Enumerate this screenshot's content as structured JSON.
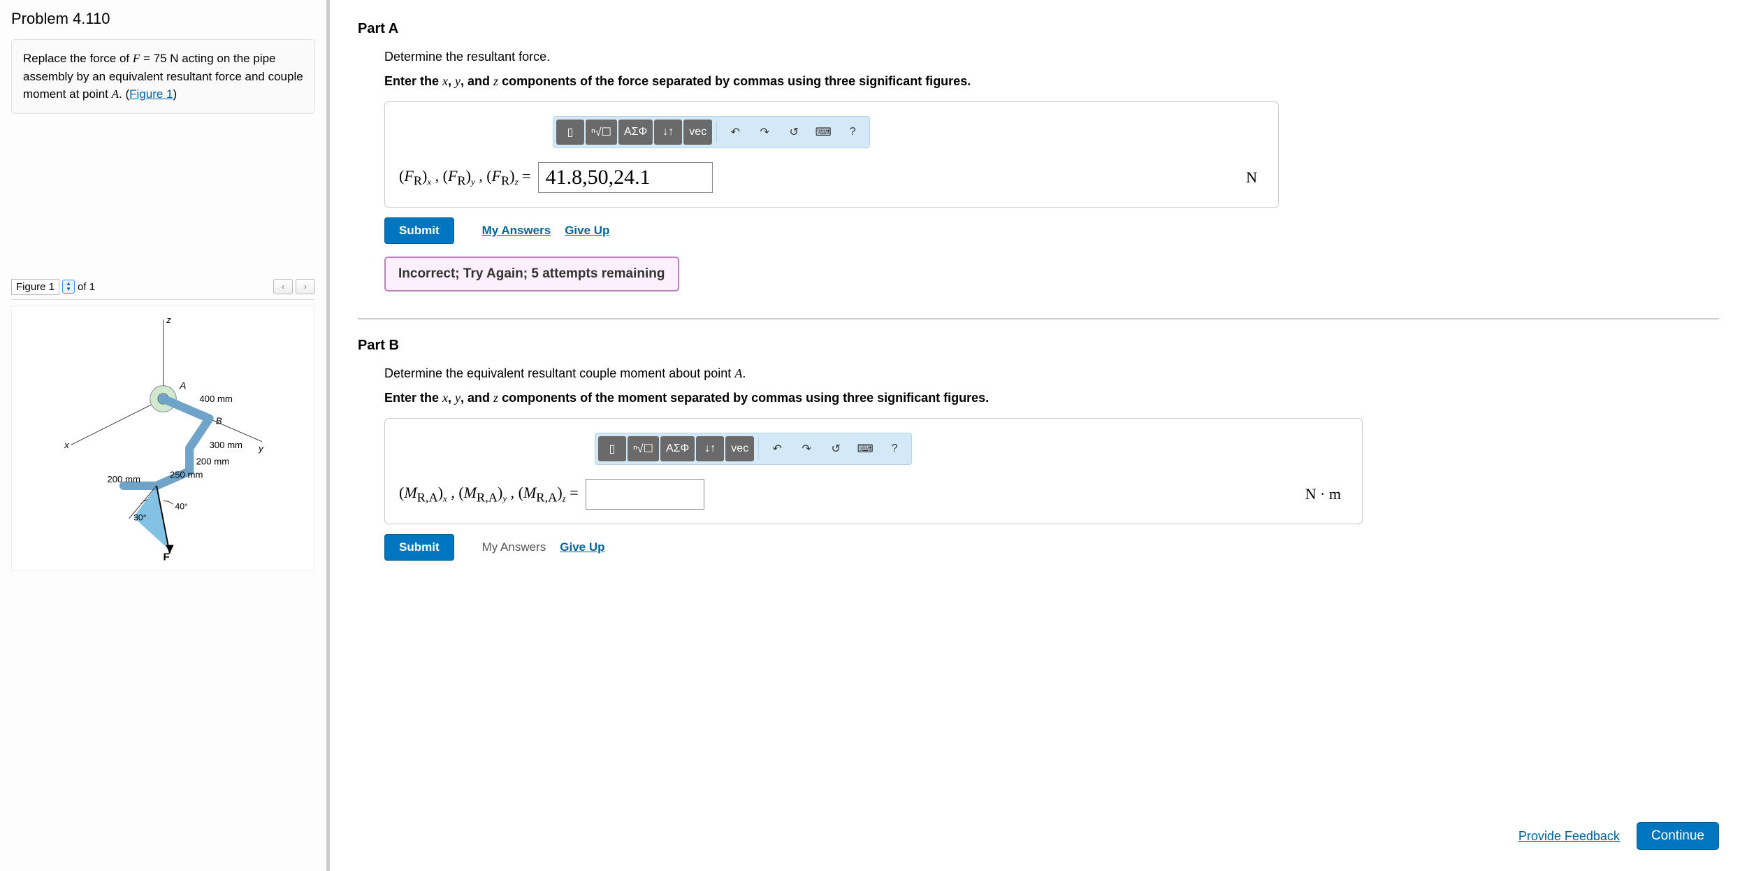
{
  "problem": {
    "title": "Problem 4.110",
    "desc_pre": "Replace the force of ",
    "desc_force_var": "F",
    "desc_force_eq": " = 75  N",
    "desc_mid": " acting on the pipe assembly by an equivalent resultant force and couple moment at point ",
    "desc_point": "A",
    "desc_post": ". (",
    "figure_link": "Figure 1",
    "desc_close": ")"
  },
  "figure": {
    "label": "Figure 1",
    "counter": "of 1",
    "dims": {
      "seg1": "400 mm",
      "seg2": "300 mm",
      "seg3": "200 mm",
      "seg4": "250 mm",
      "seg5": "200 mm",
      "angle1": "40°",
      "angle2": "30°"
    },
    "axes": {
      "x": "x",
      "y": "y",
      "z": "z"
    },
    "points": {
      "A": "A",
      "B": "B",
      "F": "F"
    }
  },
  "toolbar": {
    "templates": "▯",
    "root": "ⁿ√☐",
    "greek": "ΑΣΦ",
    "subsup": "↓↑",
    "vec": "vec",
    "undo": "↶",
    "redo": "↷",
    "reset": "↺",
    "keyboard": "⌨",
    "help": "?"
  },
  "partA": {
    "title": "Part A",
    "sub": "Determine the resultant force.",
    "instr_pre": "Enter the ",
    "instr_post": " components of the force separated by commas using three significant figures.",
    "lhs": "(F_R)_x, (F_R)_y, (F_R)_z = ",
    "value": "41.8,50,24.1",
    "unit": "N",
    "submit": "Submit",
    "my_answers": "My Answers",
    "give_up": "Give Up",
    "feedback": "Incorrect; Try Again; 5 attempts remaining"
  },
  "partB": {
    "title": "Part B",
    "sub_pre": "Determine the equivalent resultant couple moment about point ",
    "sub_point": "A",
    "sub_post": ".",
    "instr_pre": "Enter the ",
    "instr_post": " components of the moment separated by commas using three significant figures.",
    "lhs": "(M_{R,A})_x, (M_{R,A})_y, (M_{R,A})_z = ",
    "value": "",
    "unit": "N · m",
    "submit": "Submit",
    "my_answers": "My Answers",
    "give_up": "Give Up"
  },
  "footer": {
    "provide": "Provide Feedback",
    "continue": "Continue"
  },
  "vars": {
    "x": "x",
    "y": "y",
    "z": "z",
    "and": ", and "
  }
}
